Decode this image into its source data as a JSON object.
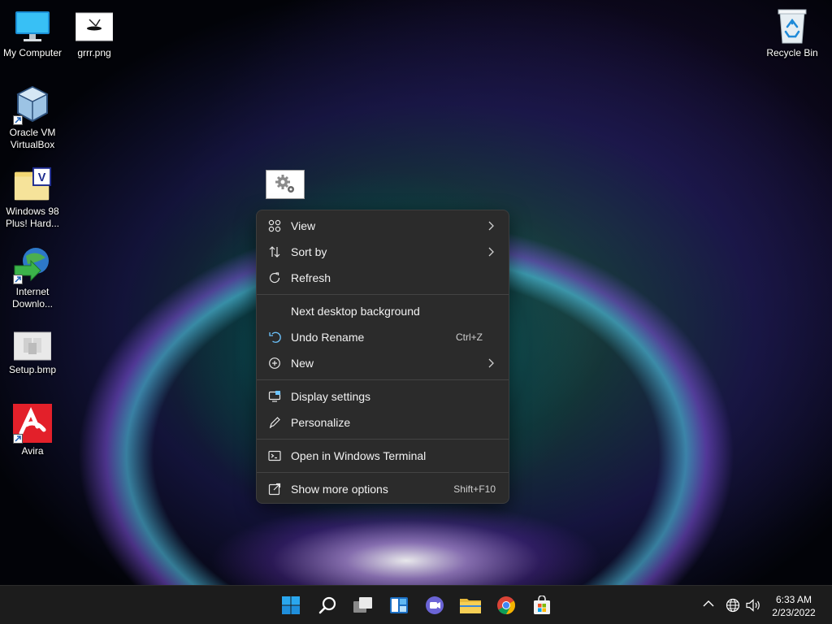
{
  "desktop_icons": [
    {
      "label": "My Computer",
      "icon": "computer-icon"
    },
    {
      "label": "grrr.png",
      "icon": "image-file-icon"
    },
    {
      "label": "Oracle VM VirtualBox",
      "icon": "virtualbox-icon"
    },
    {
      "label": "Windows 98 Plus! Hard...",
      "icon": "folder-icon"
    },
    {
      "label": "Internet Downlo...",
      "icon": "internet-download-manager-icon"
    },
    {
      "label": "Setup.bmp",
      "icon": "bitmap-file-icon"
    },
    {
      "label": "Avira",
      "icon": "avira-icon"
    },
    {
      "label": "Recycle Bin",
      "icon": "recycle-bin-icon"
    }
  ],
  "context_menu": {
    "items": [
      {
        "label": "View",
        "icon": "view-grid-icon",
        "submenu": true
      },
      {
        "label": "Sort by",
        "icon": "sort-icon",
        "submenu": true
      },
      {
        "label": "Refresh",
        "icon": "refresh-icon"
      },
      {
        "label": "Next desktop background"
      },
      {
        "label": "Undo Rename",
        "icon": "undo-icon",
        "shortcut": "Ctrl+Z"
      },
      {
        "label": "New",
        "icon": "new-plus-icon",
        "submenu": true
      },
      {
        "label": "Display settings",
        "icon": "display-icon"
      },
      {
        "label": "Personalize",
        "icon": "pen-icon"
      },
      {
        "label": "Open in Windows Terminal",
        "icon": "terminal-icon"
      },
      {
        "label": "Show more options",
        "icon": "external-icon",
        "shortcut": "Shift+F10"
      }
    ]
  },
  "taskbar": {
    "apps": [
      "start-icon",
      "search-icon",
      "task-view-icon",
      "widgets-icon",
      "teams-chat-icon",
      "file-explorer-icon",
      "chrome-icon",
      "microsoft-store-icon"
    ]
  },
  "tray": {
    "time": "6:33 AM",
    "date": "2/23/2022"
  },
  "colors": {
    "menu_bg": "#2b2b2b",
    "taskbar_bg": "#1c1c1c",
    "accent": "#4cc2ff"
  }
}
